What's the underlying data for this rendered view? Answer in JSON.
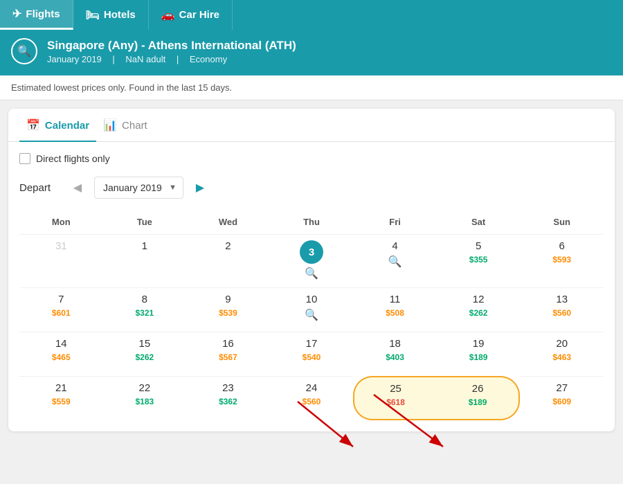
{
  "nav": {
    "tabs": [
      {
        "label": "Flights",
        "icon": "✈",
        "active": true
      },
      {
        "label": "Hotels",
        "icon": "🛏",
        "active": false
      },
      {
        "label": "Car Hire",
        "icon": "🚗",
        "active": false
      }
    ]
  },
  "search": {
    "route": "Singapore (Any) - Athens International (ATH)",
    "date": "January 2019",
    "passengers": "NaN adult",
    "class": "Economy",
    "icon": "🔍"
  },
  "notice": "Estimated lowest prices only. Found in the last 15 days.",
  "view_tabs": [
    {
      "label": "Calendar",
      "icon": "📅",
      "active": true
    },
    {
      "label": "Chart",
      "icon": "📊",
      "active": false
    }
  ],
  "direct_flights_label": "Direct flights only",
  "depart_label": "Depart",
  "month_display": "January 2019",
  "weekdays": [
    "Mon",
    "Tue",
    "Wed",
    "Thu",
    "Fri",
    "Sat",
    "Sun"
  ],
  "calendar_rows": [
    [
      {
        "day": "31",
        "other": true,
        "price": null,
        "search": false,
        "today": false
      },
      {
        "day": "1",
        "other": false,
        "price": null,
        "search": false,
        "today": false
      },
      {
        "day": "2",
        "other": false,
        "price": null,
        "search": false,
        "today": false
      },
      {
        "day": "3",
        "other": false,
        "price": null,
        "search": true,
        "today": true
      },
      {
        "day": "4",
        "other": false,
        "price": null,
        "search": true,
        "today": false
      },
      {
        "day": "5",
        "other": false,
        "price": "$355",
        "color": "green",
        "search": false,
        "today": false
      },
      {
        "day": "6",
        "other": false,
        "price": "$593",
        "color": "orange",
        "search": false,
        "today": false
      }
    ],
    [
      {
        "day": "7",
        "other": false,
        "price": "$601",
        "color": "orange",
        "search": false,
        "today": false
      },
      {
        "day": "8",
        "other": false,
        "price": "$321",
        "color": "green",
        "search": false,
        "today": false
      },
      {
        "day": "9",
        "other": false,
        "price": "$539",
        "color": "orange",
        "search": false,
        "today": false
      },
      {
        "day": "10",
        "other": false,
        "price": null,
        "search": true,
        "today": false
      },
      {
        "day": "11",
        "other": false,
        "price": "$508",
        "color": "orange",
        "search": false,
        "today": false
      },
      {
        "day": "12",
        "other": false,
        "price": "$262",
        "color": "green",
        "search": false,
        "today": false
      },
      {
        "day": "13",
        "other": false,
        "price": "$560",
        "color": "orange",
        "search": false,
        "today": false
      }
    ],
    [
      {
        "day": "14",
        "other": false,
        "price": "$465",
        "color": "orange",
        "search": false,
        "today": false
      },
      {
        "day": "15",
        "other": false,
        "price": "$262",
        "color": "green",
        "search": false,
        "today": false
      },
      {
        "day": "16",
        "other": false,
        "price": "$567",
        "color": "orange",
        "search": false,
        "today": false
      },
      {
        "day": "17",
        "other": false,
        "price": "$540",
        "color": "orange",
        "search": false,
        "today": false
      },
      {
        "day": "18",
        "other": false,
        "price": "$403",
        "color": "green",
        "search": false,
        "today": false
      },
      {
        "day": "19",
        "other": false,
        "price": "$189",
        "color": "green",
        "search": false,
        "today": false
      },
      {
        "day": "20",
        "other": false,
        "price": "$463",
        "color": "orange",
        "search": false,
        "today": false
      }
    ],
    [
      {
        "day": "21",
        "other": false,
        "price": "$559",
        "color": "orange",
        "search": false,
        "today": false
      },
      {
        "day": "22",
        "other": false,
        "price": "$183",
        "color": "green",
        "search": false,
        "today": false
      },
      {
        "day": "23",
        "other": false,
        "price": "$362",
        "color": "green",
        "search": false,
        "today": false
      },
      {
        "day": "24",
        "other": false,
        "price": "$560",
        "color": "orange",
        "search": false,
        "today": false
      },
      {
        "day": "25",
        "other": false,
        "price": "$618",
        "color": "red",
        "search": false,
        "today": false,
        "highlight": true
      },
      {
        "day": "26",
        "other": false,
        "price": "$189",
        "color": "green",
        "search": false,
        "today": false,
        "highlight": true
      },
      {
        "day": "27",
        "other": false,
        "price": "$609",
        "color": "orange",
        "search": false,
        "today": false
      }
    ]
  ],
  "colors": {
    "teal": "#1a9baa",
    "green": "#00aa6c",
    "orange": "#ff8c00",
    "red": "#e74c3c",
    "highlight_border": "#f5a623"
  }
}
